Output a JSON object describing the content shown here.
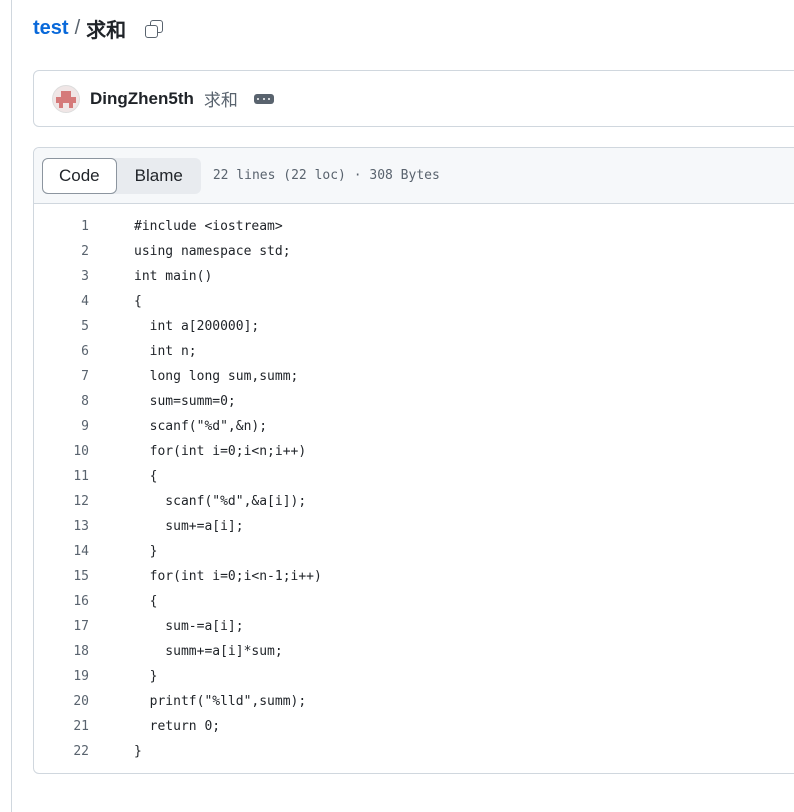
{
  "breadcrumb": {
    "repo": "test",
    "separator": "/",
    "file": "求和"
  },
  "commit": {
    "author": "DingZhen5th",
    "message": "求和"
  },
  "file_header": {
    "code_tab": "Code",
    "blame_tab": "Blame",
    "info": "22 lines (22 loc) · 308 Bytes"
  },
  "code_lines": [
    "#include <iostream>",
    "using namespace std;",
    "int main()",
    "{",
    "  int a[200000];",
    "  int n;",
    "  long long sum,summ;",
    "  sum=summ=0;",
    "  scanf(\"%d\",&n);",
    "  for(int i=0;i<n;i++)",
    "  {",
    "    scanf(\"%d\",&a[i]);",
    "    sum+=a[i];",
    "  }",
    "  for(int i=0;i<n-1;i++)",
    "  {",
    "    sum-=a[i];",
    "    summ+=a[i]*sum;",
    "  }",
    "  printf(\"%lld\",summ);",
    "  return 0;",
    "}"
  ]
}
